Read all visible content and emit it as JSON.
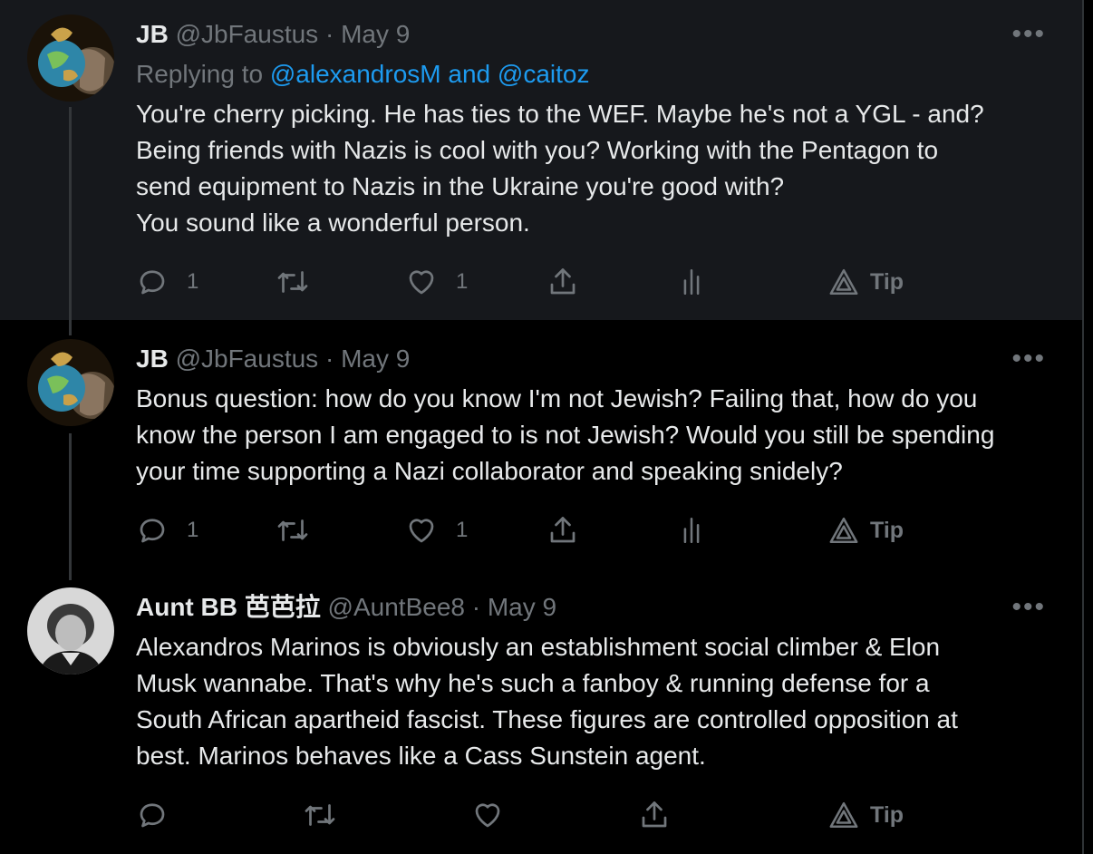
{
  "tweets": [
    {
      "name": "JB",
      "handle": "@JbFaustus",
      "dot": "·",
      "date": "May 9",
      "more": "•••",
      "reply_prefix": "Replying to",
      "reply_to_1": "@alexandrosM",
      "reply_and": "and",
      "reply_to_2": "@caitoz",
      "lines": [
        "You're cherry picking. He has ties to the WEF. Maybe he's not a YGL - and?",
        "Being friends with Nazis is cool with you? Working with the Pentagon to",
        "send equipment to Nazis in the Ukraine you're good with?",
        "You sound like a wonderful person."
      ],
      "reply_count": "1",
      "like_count": "1",
      "tip_label": "Tip"
    },
    {
      "name": "JB",
      "handle": "@JbFaustus",
      "dot": "·",
      "date": "May 9",
      "more": "•••",
      "lines": [
        "Bonus question: how do you know I'm not Jewish? Failing that, how do you",
        "know the person I am engaged to is not Jewish? Would you still be spending",
        "your time supporting a Nazi collaborator and speaking snidely?"
      ],
      "reply_count": "1",
      "like_count": "1",
      "tip_label": "Tip"
    },
    {
      "name": "Aunt BB 芭芭拉",
      "handle": "@AuntBee8",
      "dot": "·",
      "date": "May 9",
      "more": "•••",
      "lines": [
        "Alexandros Marinos is obviously an establishment social climber & Elon",
        "Musk wannabe. That's why he's such a fanboy & running defense for a",
        "South African apartheid fascist. These figures are controlled opposition at",
        "best. Marinos behaves like a Cass Sunstein agent."
      ],
      "tip_label": "Tip"
    }
  ],
  "colors": {
    "text": "#e7e9ea",
    "muted": "#71767b",
    "link": "#1d9bf0",
    "panel": "#16181c",
    "bg": "#000000"
  },
  "icons": [
    "reply-icon",
    "retweet-icon",
    "like-icon",
    "share-icon",
    "analytics-icon",
    "tip-icon",
    "more-icon"
  ]
}
